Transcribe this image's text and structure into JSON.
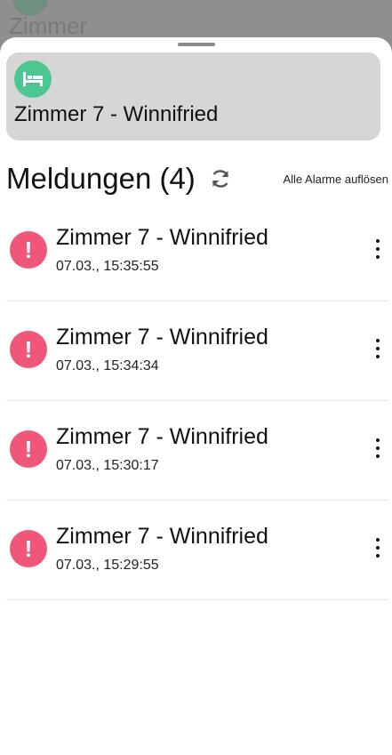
{
  "background": {
    "title": "Zimmer"
  },
  "room": {
    "icon": "bed-icon",
    "title": "Zimmer 7 - Winnifried",
    "accent_color": "#4cc792"
  },
  "alerts_section": {
    "title": "Meldungen (4)",
    "refresh_icon": "refresh-icon",
    "resolve_all_label": "Alle Alarme auflösen"
  },
  "alerts": [
    {
      "title": "Zimmer 7 - Winnifried",
      "time": "07.03., 15:35:55",
      "icon": "exclamation-icon",
      "icon_color": "#f0567a"
    },
    {
      "title": "Zimmer 7 - Winnifried",
      "time": "07.03., 15:34:34",
      "icon": "exclamation-icon",
      "icon_color": "#f0567a"
    },
    {
      "title": "Zimmer 7 - Winnifried",
      "time": "07.03., 15:30:17",
      "icon": "exclamation-icon",
      "icon_color": "#f0567a"
    },
    {
      "title": "Zimmer 7 - Winnifried",
      "time": "07.03., 15:29:55",
      "icon": "exclamation-icon",
      "icon_color": "#f0567a"
    }
  ],
  "alert_icon_glyph": "!"
}
